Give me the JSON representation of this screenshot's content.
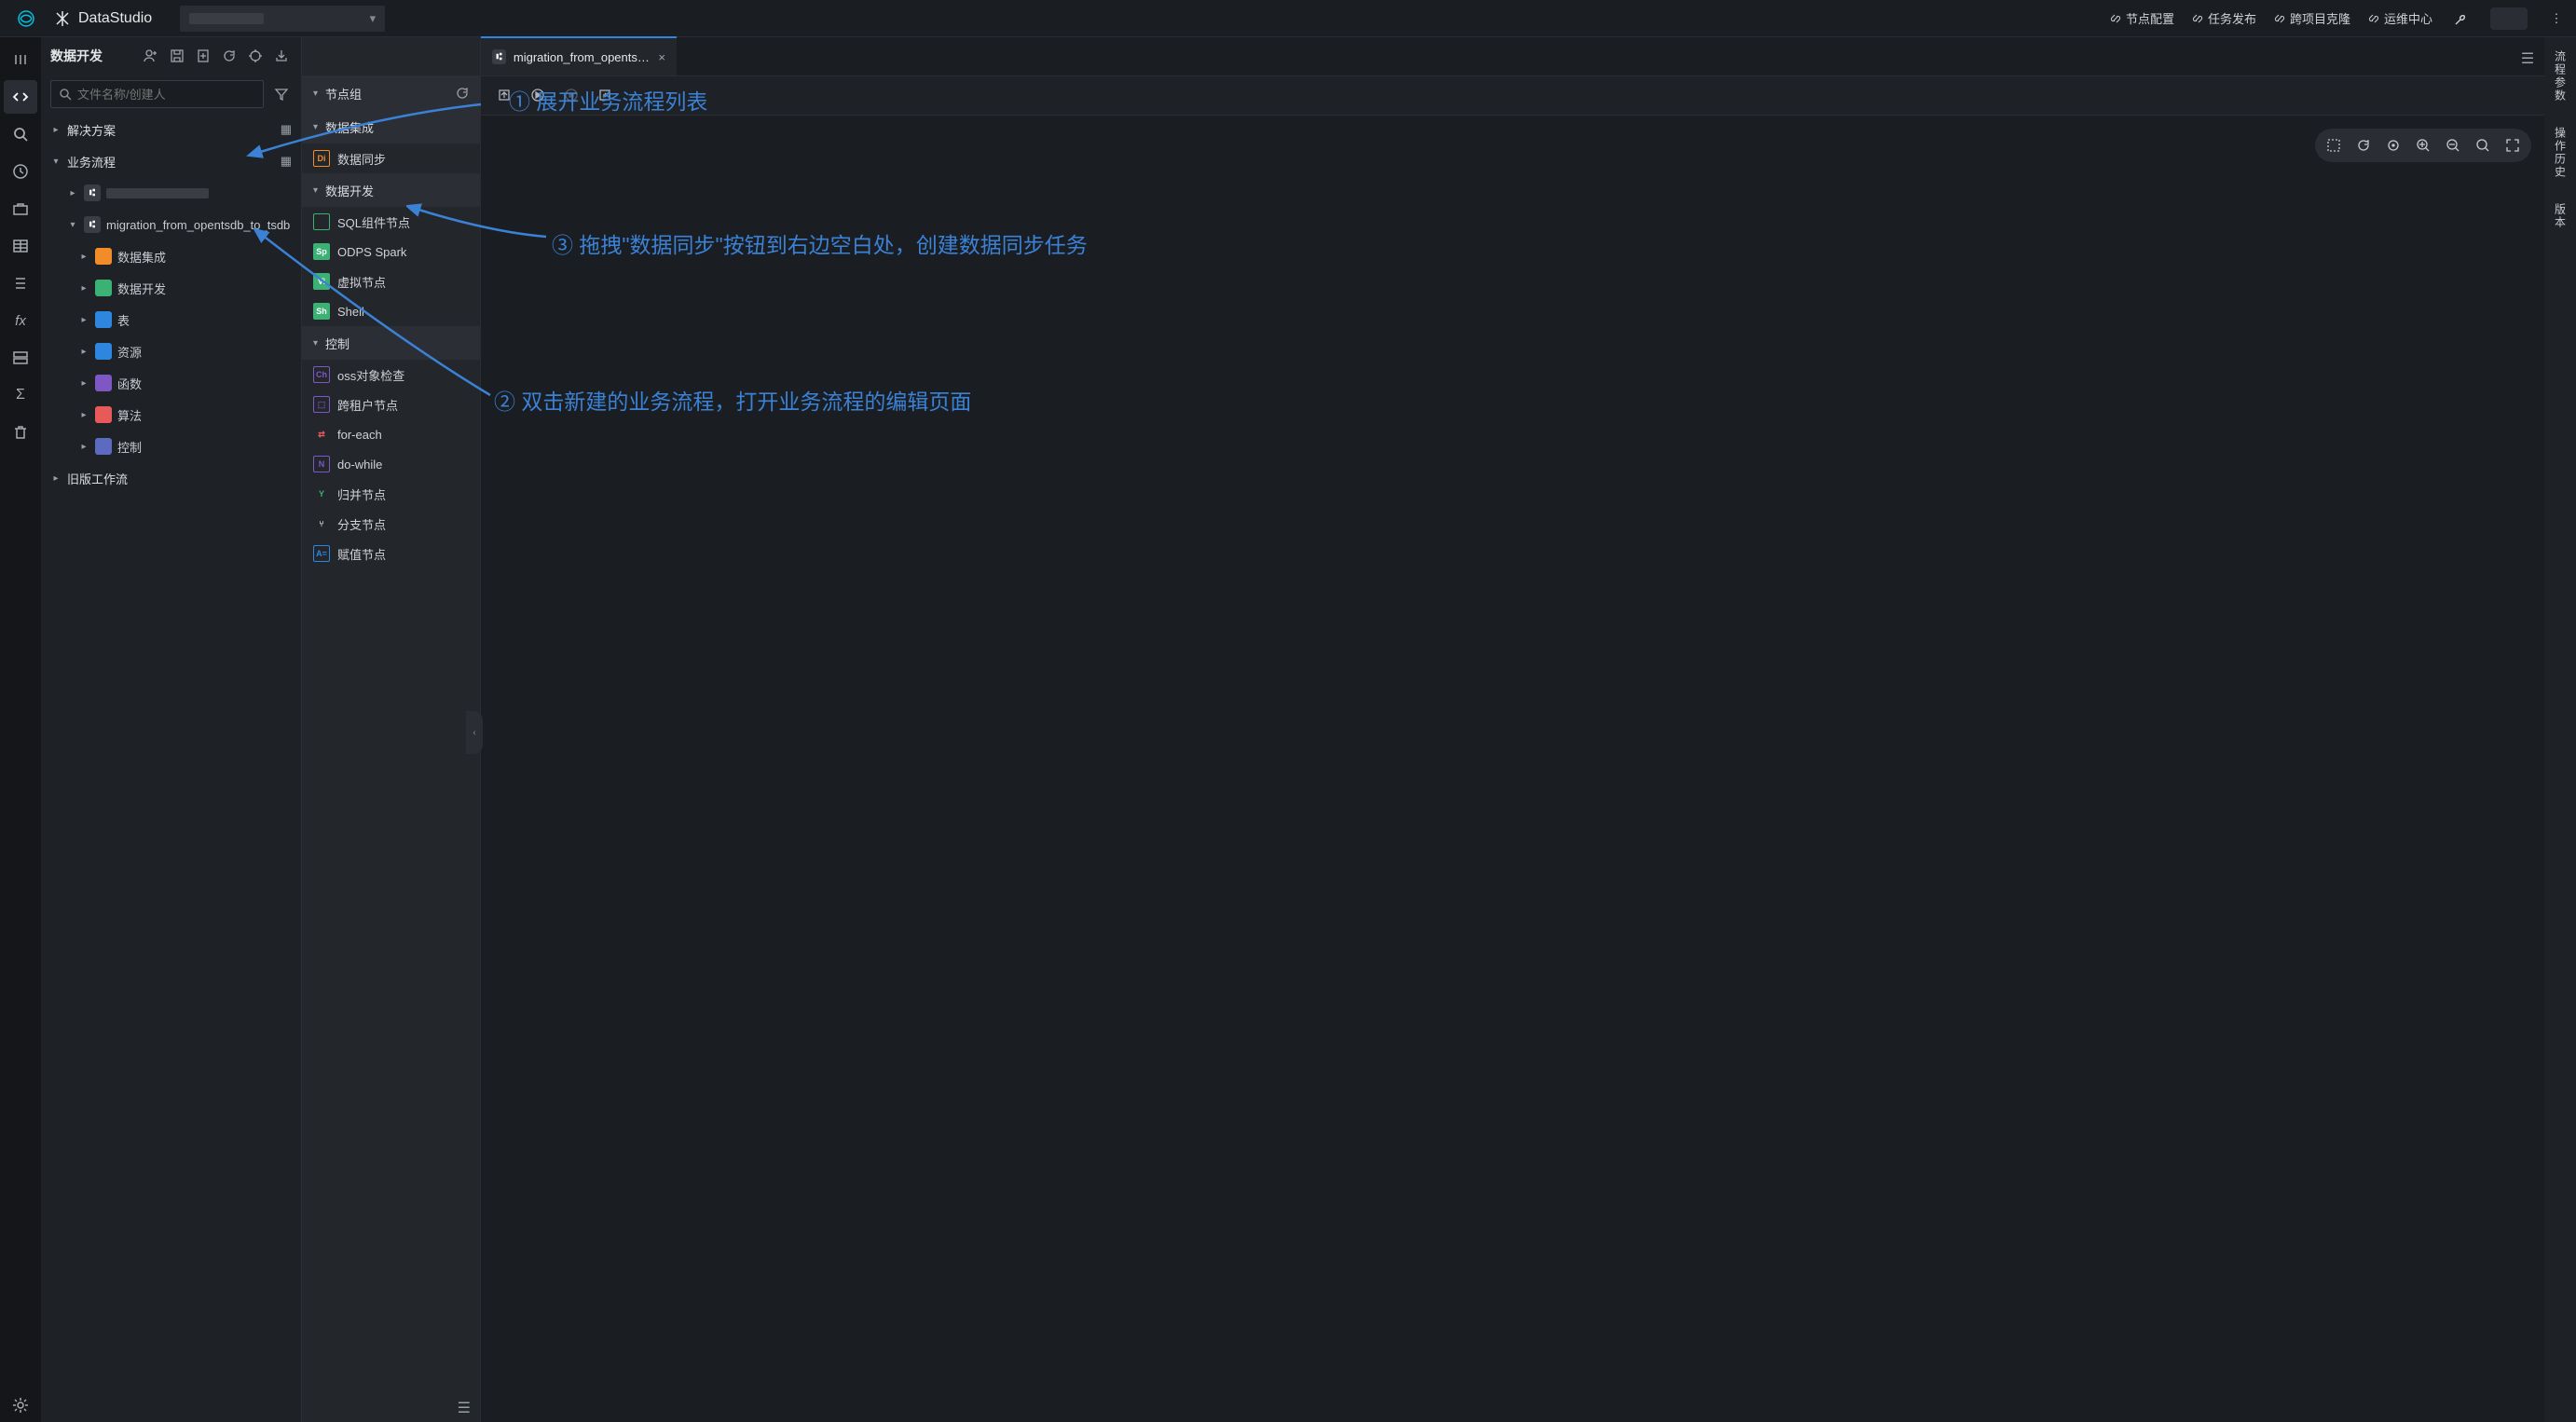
{
  "brand": "DataStudio",
  "top_links": [
    {
      "label": "节点配置"
    },
    {
      "label": "任务发布"
    },
    {
      "label": "跨项目克隆"
    },
    {
      "label": "运维中心"
    }
  ],
  "left": {
    "title": "数据开发",
    "search_placeholder": "文件名称/创建人",
    "sections": {
      "solutions": "解决方案",
      "workflows": "业务流程",
      "legacy": "旧版工作流"
    },
    "workflow_item_redacted": "",
    "workflow_item_open": "migration_from_opentsdb_to_tsdb",
    "children": [
      {
        "label": "数据集成",
        "cls": "orange"
      },
      {
        "label": "数据开发",
        "cls": "green"
      },
      {
        "label": "表",
        "cls": "blue"
      },
      {
        "label": "资源",
        "cls": "blue"
      },
      {
        "label": "函数",
        "cls": "purple"
      },
      {
        "label": "算法",
        "cls": "red"
      },
      {
        "label": "控制",
        "cls": "vio"
      }
    ]
  },
  "palette": {
    "group_node": "节点组",
    "group_di": "数据集成",
    "item_di": "数据同步",
    "group_dev": "数据开发",
    "items_dev": [
      {
        "label": "SQL组件节点",
        "cls": "sql",
        "t": ""
      },
      {
        "label": "ODPS Spark",
        "cls": "sp",
        "t": "Sp"
      },
      {
        "label": "虚拟节点",
        "cls": "vi",
        "t": "Vi"
      },
      {
        "label": "Shell",
        "cls": "sh",
        "t": "Sh"
      }
    ],
    "group_ctrl": "控制",
    "items_ctrl": [
      {
        "label": "oss对象检查",
        "cls": "ch",
        "t": "Ch"
      },
      {
        "label": "跨租户节点",
        "cls": "ct",
        "t": "⬚"
      },
      {
        "label": "for-each",
        "cls": "fe",
        "t": "⇄"
      },
      {
        "label": "do-while",
        "cls": "n",
        "t": "N"
      },
      {
        "label": "归并节点",
        "cls": "mg",
        "t": "Y"
      },
      {
        "label": "分支节点",
        "cls": "br",
        "t": "⑂"
      },
      {
        "label": "赋值节点",
        "cls": "as",
        "t": "A="
      }
    ]
  },
  "tab": {
    "label": "migration_from_opentsdb..."
  },
  "right_rail": [
    "流程参数",
    "操作历史",
    "版本"
  ],
  "annotations": {
    "a1": "① 展开业务流程列表",
    "a2": "② 双击新建的业务流程，打开业务流程的编辑页面",
    "a3": "③ 拖拽\"数据同步\"按钮到右边空白处，创建数据同步任务"
  }
}
